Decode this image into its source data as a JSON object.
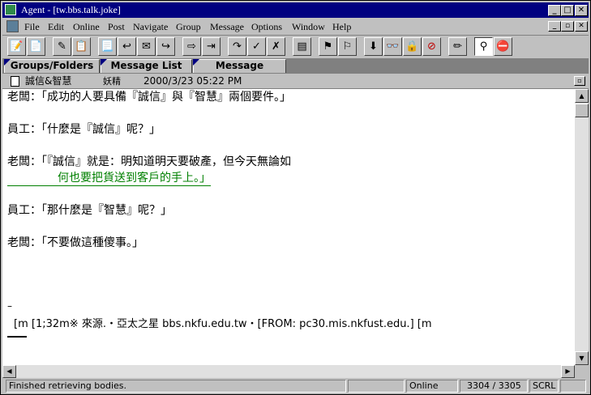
{
  "window": {
    "title": "Agent - [tw.bbs.talk.joke]"
  },
  "menu": [
    "File",
    "Edit",
    "Online",
    "Post",
    "Navigate",
    "Group",
    "Message",
    "Options",
    "Window",
    "Help"
  ],
  "toolbar_icons": [
    "new-post-icon",
    "new-post-alt-icon",
    "edit-post-icon",
    "copy-icon",
    "new-message-icon",
    "reply-post-icon",
    "reply-message-icon",
    "forward-icon",
    "forward-alt-icon",
    "skip-icon",
    "skip-thread-icon",
    "mark-read-icon",
    "unmark-icon",
    "html-view-icon",
    "flag-icon",
    "flag-thread-icon",
    "download-icon",
    "watch-icon",
    "lock-icon",
    "cancel-icon",
    "highlighter-icon",
    "tree-view-icon",
    "stop-icon"
  ],
  "tabs": {
    "groups": "Groups/Folders",
    "list": "Message List",
    "message": "Message"
  },
  "message": {
    "subject": "誠信&智慧",
    "author": "妖精",
    "date": "2000/3/23 05:22 PM",
    "lines": [
      "老闆：「成功的人要具備『誠信』與『智慧』兩個要件。」",
      "員工：「什麼是『誠信』呢？」",
      "老闆：「『誠信』就是：明知道明天要破產，但今天無論如",
      "何也要把貨送到客戶的手上。」",
      "員工：「那什麼是『智慧』呢？」",
      "老闆：「不要做這種傻事。」"
    ],
    "sig_dash": "–",
    "sig_line": "[m [1;32m※ 來源.・亞太之星 bbs.nkfu.edu.tw・[FROM: pc30.mis.nkfust.edu.] [m"
  },
  "status": {
    "text": "Finished retrieving bodies.",
    "online": "Online",
    "count": "3304 / 3305",
    "scrl": "SCRL"
  },
  "colors": {
    "titlebar": "#000080",
    "link": "#008000",
    "face": "#c0c0c0"
  }
}
